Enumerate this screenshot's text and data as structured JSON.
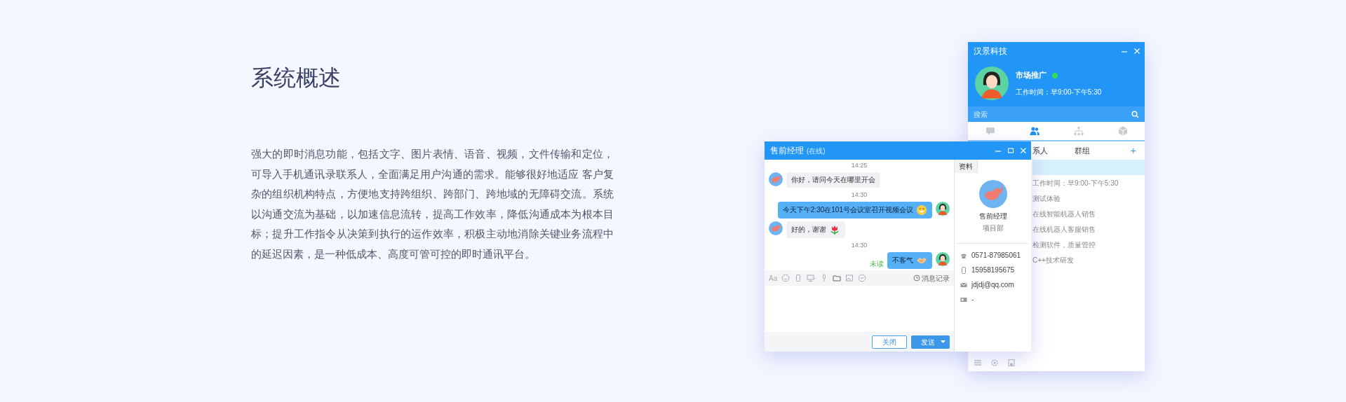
{
  "heading": "系统概述",
  "description": "强大的即时消息功能，包括文字、图片表情、语音、视频，文件传输和定位，可导入手机通讯录联系人，全面满足用户沟通的需求。能够很好地适应 客户复杂的组织机构特点，方便地支持跨组织、跨部门、跨地域的无障碍交流。系统以沟通交流为基础，以加速信息流转，提高工作效率，降低沟通成本为根本目标；提升工作指令从决策到执行的运作效率，积极主动地消除关键业务流程中的延迟因素，是一种低成本、高度可管可控的即时通讯平台。",
  "contacts_window": {
    "title": "汉景科技",
    "profile": {
      "name": "市场推广",
      "online": true,
      "hours": "工作时间：早9:00-下午5:30"
    },
    "search": {
      "placeholder": "搜索"
    },
    "tabs": [
      {
        "kind": "messages",
        "selected": false
      },
      {
        "kind": "contacts",
        "selected": true
      },
      {
        "kind": "org",
        "selected": false
      },
      {
        "kind": "apps",
        "selected": false
      }
    ],
    "sub_tabs": [
      "系人",
      "群组"
    ],
    "add_button": "+",
    "rows": [
      {
        "selected": true
      },
      {
        "text": "工作时间：早9:00-下午5:30",
        "selected": false
      },
      {
        "text": "测试体验",
        "selected": false
      },
      {
        "text": "在线智能机器人销售",
        "selected": false
      },
      {
        "text": "在线机器人客服销售",
        "selected": false
      },
      {
        "text": "检测软件，质量管控",
        "selected": false
      },
      {
        "text": "C++技术研发",
        "selected": false
      }
    ]
  },
  "chat_window": {
    "title": "售前经理",
    "status": "(在线)",
    "messages": [
      {
        "kind": "time",
        "text": "14:25"
      },
      {
        "kind": "incoming",
        "text": "你好，请问今天在哪里开会"
      },
      {
        "kind": "time",
        "text": "14:30"
      },
      {
        "kind": "outgoing",
        "text": "今天下午2:30在101号会议室召开视频会议"
      },
      {
        "kind": "incoming",
        "text": "好的，谢谢"
      },
      {
        "kind": "time",
        "text": "14:30"
      },
      {
        "kind": "outgoing",
        "text": "不客气",
        "receipt": "未读"
      }
    ],
    "toolbar": {
      "font_button": "Aa",
      "history": "消息记录"
    },
    "buttons": [
      {
        "label": "关闭",
        "kind": "secondary"
      },
      {
        "label": "发送",
        "kind": "primary"
      }
    ],
    "profile_tab": "资料",
    "profile": {
      "name": "售前经理",
      "department": "项目部",
      "details": [
        {
          "kind": "phone",
          "text": "0571-87985061"
        },
        {
          "kind": "mobile",
          "text": "15958195675"
        },
        {
          "kind": "email",
          "text": "jdjdj@qq.com"
        },
        {
          "kind": "card",
          "text": "-"
        }
      ]
    }
  }
}
